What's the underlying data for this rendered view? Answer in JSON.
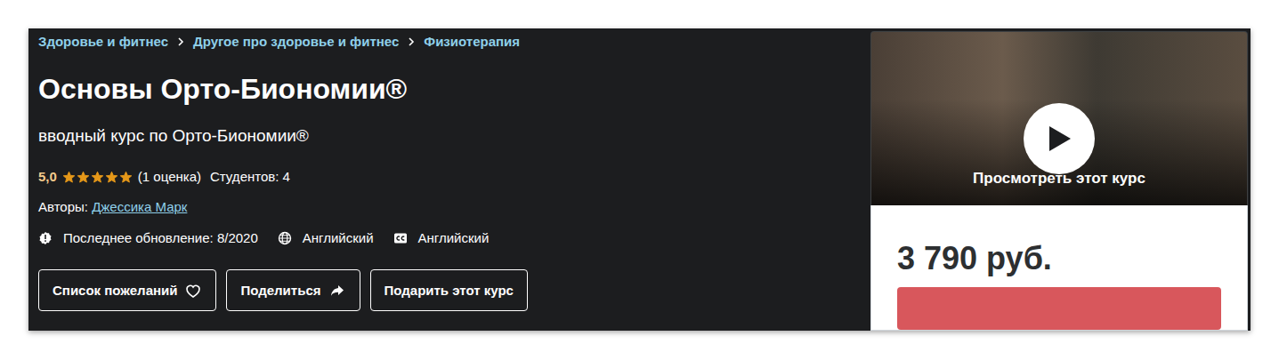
{
  "breadcrumbs": [
    "Здоровье и фитнес",
    "Другое про здоровье и фитнес",
    "Физиотерапия"
  ],
  "title": "Основы Орто-Биономии®",
  "subtitle": "вводный курс по Орто-Биономии®",
  "rating": {
    "value": "5,0",
    "stars": 5,
    "count": "(1 оценка)"
  },
  "students": "Студентов: 4",
  "authors": {
    "label": "Авторы:",
    "name": "Джессика Марк"
  },
  "meta": [
    {
      "kind": "update",
      "text": "Последнее обновление: 8/2020"
    },
    {
      "kind": "language",
      "text": "Английский"
    },
    {
      "kind": "captions",
      "text": "Английский"
    }
  ],
  "buttons": [
    {
      "kind": "wishlist",
      "label": "Список пожеланий"
    },
    {
      "kind": "share",
      "label": "Поделиться"
    },
    {
      "kind": "gift",
      "label": "Подарить этот курс"
    }
  ],
  "preview": {
    "label": "Просмотреть этот курс"
  },
  "price": "3 790 руб."
}
